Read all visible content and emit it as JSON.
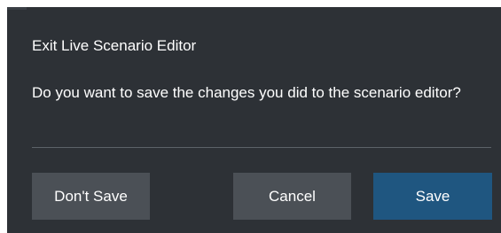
{
  "dialog": {
    "title": "Exit Live Scenario Editor",
    "message": "Do you want to save the changes you did to the scenario editor?",
    "buttons": {
      "dont_save": "Don't Save",
      "cancel": "Cancel",
      "save": "Save"
    }
  },
  "colors": {
    "background": "#2d3136",
    "secondary_button": "#4b5056",
    "primary_button": "#1f5680",
    "divider": "#5c6268",
    "text": "#ffffff"
  }
}
